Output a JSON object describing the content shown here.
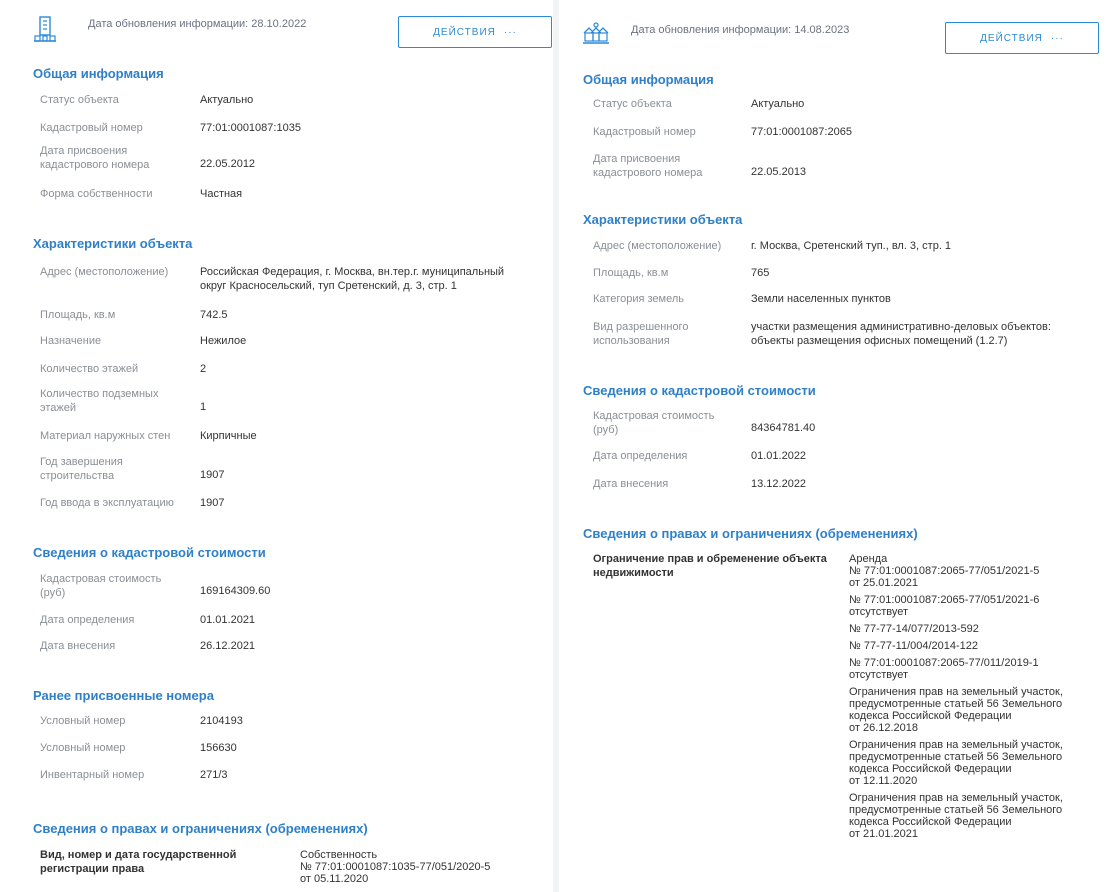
{
  "actions_label": "действия",
  "actions_dots": "···",
  "left": {
    "update_date": "Дата обновления информации: 28.10.2022",
    "general": {
      "title": "Общая информация",
      "rows": [
        {
          "label": "Статус объекта",
          "value": "Актуально"
        },
        {
          "label": "Кадастровый номер",
          "value": "77:01:0001087:1035"
        },
        {
          "label": [
            "Дата присвоения",
            "кадастрового номера"
          ],
          "value": "22.05.2012"
        },
        {
          "label": "Форма собственности",
          "value": "Частная"
        }
      ]
    },
    "chars": {
      "title": "Характеристики объекта",
      "rows": [
        {
          "label": "Адрес (местоположение)",
          "value": [
            "Российская Федерация, г. Москва, вн.тер.г. муниципальный",
            "округ Красносельский, туп Сретенский, д. 3, стр. 1"
          ]
        },
        {
          "label": "Площадь, кв.м",
          "value": "742.5"
        },
        {
          "label": "Назначение",
          "value": "Нежилое"
        },
        {
          "label": "Количество этажей",
          "value": "2"
        },
        {
          "label": [
            "Количество подземных",
            "этажей"
          ],
          "value": "1"
        },
        {
          "label": "Материал наружных стен",
          "value": "Кирпичные"
        },
        {
          "label": [
            "Год завершения",
            "строительства"
          ],
          "value": "1907"
        },
        {
          "label": "Год ввода в эксплуатацию",
          "value": "1907"
        }
      ]
    },
    "cadastral": {
      "title": "Сведения о кадастровой стоимости",
      "rows": [
        {
          "label": [
            "Кадастровая стоимость",
            "(руб)"
          ],
          "value": "169164309.60"
        },
        {
          "label": "Дата определения",
          "value": "01.01.2021"
        },
        {
          "label": "Дата внесения",
          "value": "26.12.2021"
        }
      ]
    },
    "previous": {
      "title": "Ранее присвоенные номера",
      "rows": [
        {
          "label": "Условный номер",
          "value": "2104193"
        },
        {
          "label": "Условный номер",
          "value": "156630"
        },
        {
          "label": "Инвентарный номер",
          "value": "271/3"
        }
      ]
    },
    "rights": {
      "title": "Сведения о правах и ограничениях (обременениях)",
      "label": [
        "Вид, номер и дата государственной",
        "регистрации права"
      ],
      "value": [
        "Собственность",
        "№ 77:01:0001087:1035-77/051/2020-5",
        "от 05.11.2020"
      ]
    }
  },
  "right": {
    "update_date": "Дата обновления информации: 14.08.2023",
    "general": {
      "title": "Общая информация",
      "rows": [
        {
          "label": "Статус объекта",
          "value": "Актуально"
        },
        {
          "label": "Кадастровый номер",
          "value": "77:01:0001087:2065"
        },
        {
          "label": [
            "Дата присвоения",
            "кадастрового номера"
          ],
          "value": "22.05.2013"
        }
      ]
    },
    "chars": {
      "title": "Характеристики объекта",
      "rows": [
        {
          "label": "Адрес (местоположение)",
          "value": "г. Москва, Сретенский туп., вл. 3, стр. 1"
        },
        {
          "label": "Площадь, кв.м",
          "value": "765"
        },
        {
          "label": "Категория земель",
          "value": "Земли населенных пунктов"
        },
        {
          "label": [
            "Вид разрешенного",
            "использования"
          ],
          "value": [
            "участки размещения административно-деловых объектов:",
            "объекты размещения офисных помещений (1.2.7)"
          ]
        }
      ]
    },
    "cadastral": {
      "title": "Сведения о кадастровой стоимости",
      "rows": [
        {
          "label": [
            "Кадастровая стоимость",
            "(руб)"
          ],
          "value": "84364781.40"
        },
        {
          "label": "Дата определения",
          "value": "01.01.2022"
        },
        {
          "label": "Дата внесения",
          "value": "13.12.2022"
        }
      ]
    },
    "rights": {
      "title": "Сведения о правах и ограничениях (обременениях)",
      "label": [
        "Ограничение прав и обременение объекта",
        "недвижимости"
      ],
      "entries": [
        [
          "Аренда",
          "№ 77:01:0001087:2065-77/051/2021-5",
          "от 25.01.2021"
        ],
        [
          "№ 77:01:0001087:2065-77/051/2021-6",
          "отсутствует"
        ],
        [
          "№ 77-77-14/077/2013-592"
        ],
        [
          "№ 77-77-11/004/2014-122"
        ],
        [
          "№ 77:01:0001087:2065-77/011/2019-1",
          "отсутствует"
        ],
        [
          "Ограничения прав на земельный участок,",
          "предусмотренные статьей 56 Земельного",
          "кодекса Российской Федерации",
          "от 26.12.2018"
        ],
        [
          "Ограничения прав на земельный участок,",
          "предусмотренные статьей 56 Земельного",
          "кодекса Российской Федерации",
          "от 12.11.2020"
        ],
        [
          "Ограничения прав на земельный участок,",
          "предусмотренные статьей 56 Земельного",
          "кодекса Российской Федерации",
          "от 21.01.2021"
        ]
      ]
    }
  },
  "colors": {
    "accent": "#2f80c8",
    "label": "#8a8f96",
    "text": "#333333",
    "button": "#2b8ad8"
  },
  "icons": {
    "left": "building-icon",
    "right": "houses-icon"
  }
}
